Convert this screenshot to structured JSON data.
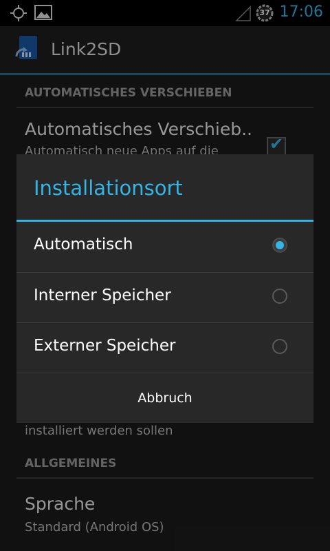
{
  "status_bar": {
    "time": "17:06",
    "battery_level": "37",
    "icons": [
      "gps-icon",
      "image-icon",
      "signal-icon",
      "battery-icon"
    ]
  },
  "action_bar": {
    "title": "Link2SD",
    "icon": "link2sd-app-icon"
  },
  "background": {
    "section1_header": "AUTOMATISCHES VERSCHIEBEN",
    "pref1_title": "Automatisches Verschieb..",
    "pref1_summary": "Automatisch neue Apps auf die",
    "pref2_summary_tail": "installiert werden sollen",
    "section2_header": "ALLGEMEINES",
    "pref3_title": "Sprache",
    "pref3_summary": "Standard (Android OS)"
  },
  "dialog": {
    "title": "Installationsort",
    "options": [
      {
        "label": "Automatisch",
        "selected": true
      },
      {
        "label": "Interner Speicher",
        "selected": false
      },
      {
        "label": "Externer Speicher",
        "selected": false
      }
    ],
    "cancel_label": "Abbruch"
  },
  "colors": {
    "accent": "#33b5e5",
    "dialog_bg": "#282828",
    "background": "#1b1b1b"
  }
}
